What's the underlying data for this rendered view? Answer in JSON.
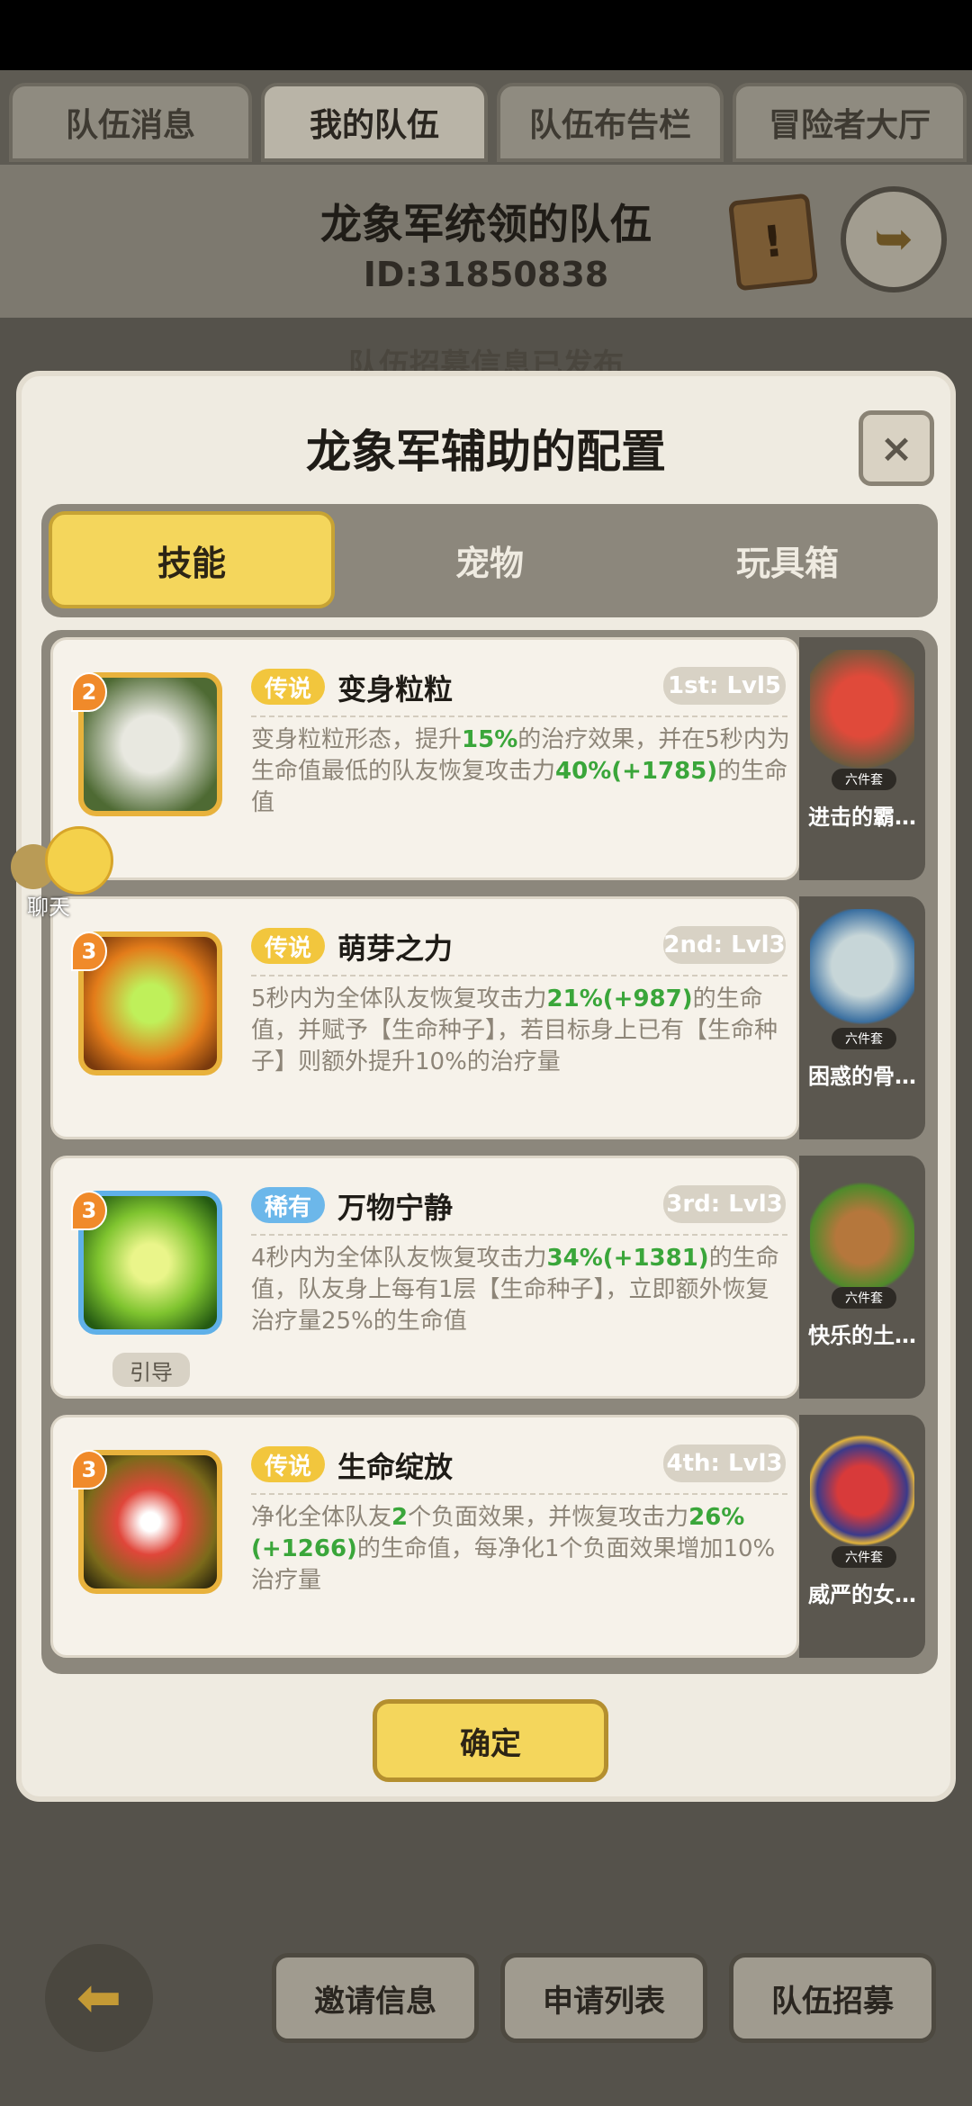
{
  "top_tabs": [
    "队伍消息",
    "我的队伍",
    "队伍布告栏",
    "冒险者大厅"
  ],
  "team": {
    "title": "龙象军统领的队伍",
    "id": "ID:31850838"
  },
  "behind_notice": "队伍招募信息已发布",
  "modal": {
    "title": "龙象军辅助的配置",
    "close": "×",
    "tabs": [
      "技能",
      "宠物",
      "玩具箱"
    ],
    "confirm": "确定"
  },
  "chat_label": "聊天",
  "skills": [
    {
      "badge": "2",
      "rarity": "传说",
      "name": "变身粒粒",
      "level": "1st: Lvl5",
      "desc_parts": [
        "变身粒粒形态，提升",
        "15%",
        "的治疗效果，并在5秒内为生命值最低的队友恢复攻击力",
        "40%(+1785)",
        "的生命值"
      ],
      "guide": "",
      "pet": "进击的霸…",
      "set": "六件套"
    },
    {
      "badge": "3",
      "rarity": "传说",
      "name": "萌芽之力",
      "level": "2nd: Lvl3",
      "desc_parts": [
        "5秒内为全体队友恢复攻击力",
        "21%(+987)",
        "的生命值，并赋予【生命种子】，若目标身上已有【生命种子】则额外提升10%的治疗量",
        "",
        ""
      ],
      "guide": "",
      "pet": "困惑的骨…",
      "set": "六件套"
    },
    {
      "badge": "3",
      "rarity": "稀有",
      "name": "万物宁静",
      "level": "3rd: Lvl3",
      "desc_parts": [
        "4秒内为全体队友恢复攻击力",
        "34%(+1381)",
        "的生命值，队友身上每有1层【生命种子】，立即额外恢复治疗量25%的生命值",
        "",
        ""
      ],
      "guide": "引导",
      "pet": "快乐的土…",
      "set": "六件套"
    },
    {
      "badge": "3",
      "rarity": "传说",
      "name": "生命绽放",
      "level": "4th: Lvl3",
      "desc_parts": [
        "净化全体队友",
        "2",
        "个负面效果，并恢复攻击力",
        "26%(+1266)",
        "的生命值，每净化1个负面效果增加10%治疗量"
      ],
      "guide": "",
      "pet": "威严的女…",
      "set": "六件套"
    }
  ],
  "bottom": {
    "invite": "邀请信息",
    "apply": "申请列表",
    "recruit": "队伍招募"
  }
}
